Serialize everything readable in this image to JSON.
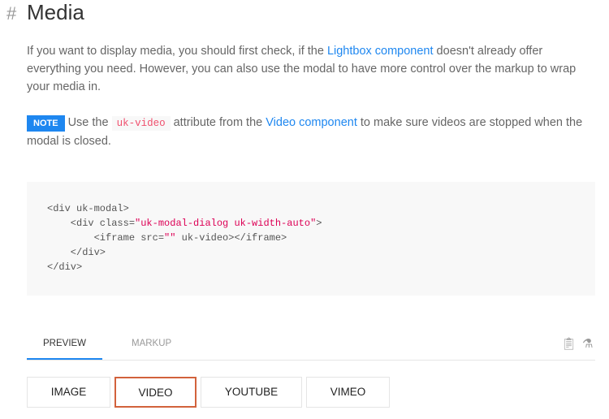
{
  "heading": {
    "hash": "#",
    "title": "Media"
  },
  "intro": {
    "t1": "If you want to display media, you should first check, if the ",
    "link": "Lightbox component",
    "t2": " doesn't already offer everything you need. However, you can also use the modal to have more control over the markup to wrap your media in."
  },
  "note": {
    "badge": "NOTE",
    "t1": "Use the ",
    "code": "uk-video",
    "t2": " attribute from the ",
    "link": "Video component",
    "t3": " to make sure videos are stopped when the modal is closed."
  },
  "code": {
    "l1": "<div uk-modal>",
    "l2a": "    <div class=",
    "l2b": "\"uk-modal-dialog uk-width-auto\"",
    "l2c": ">",
    "l3a": "        <iframe src=",
    "l3b": "\"\"",
    "l3c": " uk-video></iframe>",
    "l4": "    </div>",
    "l5": "</div>"
  },
  "tabs": {
    "preview": "PREVIEW",
    "markup": "MARKUP"
  },
  "buttons": [
    "IMAGE",
    "VIDEO",
    "YOUTUBE",
    "VIMEO"
  ]
}
